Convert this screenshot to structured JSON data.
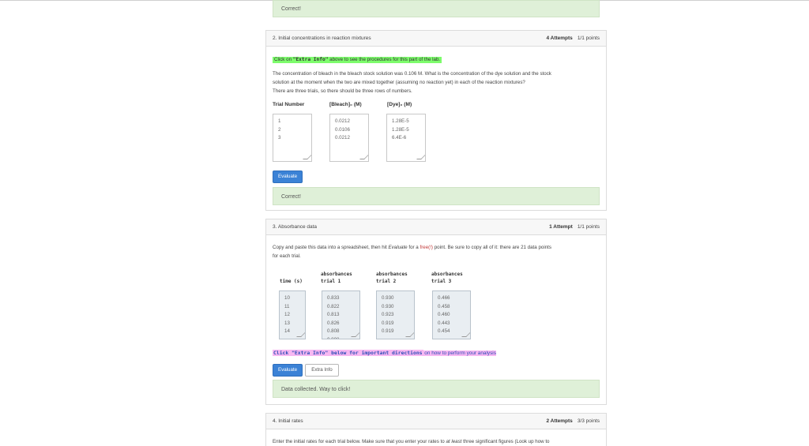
{
  "top_feedback": "Correct!",
  "q2": {
    "title": "2. Initial concentrations in reaction mixtures",
    "attempts": "4 Attempts",
    "points": "1/1 points",
    "hint": "Click on \"Extra Info\" above to see the procedures for this part of the lab.",
    "hint_prefix": "Click on ",
    "hint_code": "\"Extra Info\"",
    "hint_suffix": " above to see the procedures for this part of the lab.",
    "body_line1": "The concentration of bleach in the bleach stock solution was 0.106 M. What is the concentration of the dye solution and the stock",
    "body_line2": "solution at the moment when the two are mixed together (assuming no reaction yet) in each of the reaction mixtures?",
    "body_line3": "There are three trials, so there should be three rows of numbers.",
    "col_trial": "Trial Number",
    "col_bleach": "[Bleach]₀ (M)",
    "col_dye": "[Dye]₀ (M)",
    "trials": "1\n2\n3",
    "bleach_values": "0.0212\n0.0106\n0.0212",
    "dye_values": "1.28E-5\n1.28E-5\n6.4E-6",
    "evaluate_label": "Evaluate",
    "feedback": "Correct!"
  },
  "q3": {
    "title": "3. Absorbance data",
    "attempts": "1 Attempt",
    "points": "1/1 points",
    "body_line1_a": "Copy and paste this data into a spreadsheet, then hit ",
    "body_line1_i": "Evaluate",
    "body_line1_b": " for a ",
    "body_line1_link": "free(!)",
    "body_line1_c": " point. Be sure to copy all of it: there are 21 data points",
    "body_line2": "for each trial.",
    "col_time": "time (s)",
    "col_t1_a": "absorbances",
    "col_t1_b": "trial 1",
    "col_t2_a": "absorbances",
    "col_t2_b": "trial 2",
    "col_t3_a": "absorbances",
    "col_t3_b": "trial 3",
    "time_values": "10\n11\n12\n13\n14",
    "trial1_values": "0.833\n0.822\n0.813\n0.826\n0.808\n0.808",
    "trial2_values": "0.930\n0.930\n0.923\n0.919\n0.919",
    "trial3_values": "0.466\n0.458\n0.460\n0.443\n0.454",
    "extra_code": "Click \"Extra Info\" below for important directions",
    "extra_text": " on how to perform your analysis",
    "evaluate_label": "Evaluate",
    "extra_info_label": "Extra Info",
    "feedback": "Data collected. Way to click!"
  },
  "q4": {
    "title": "4. Initial rates",
    "attempts": "2 Attempts",
    "points": "3/3 points",
    "body_a": "Enter the initial rates for each trial below.  Make sure that you enter your rates to ",
    "body_i": "at least",
    "body_b": " three significant figures (Look up how to"
  }
}
